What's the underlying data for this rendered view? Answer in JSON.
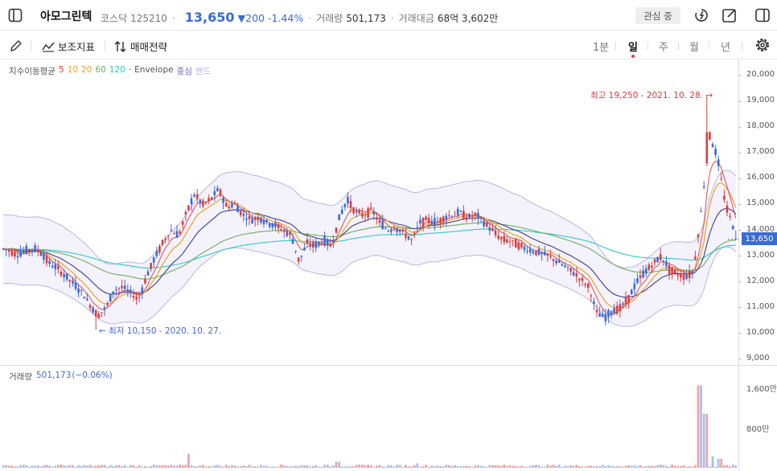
{
  "header": {
    "stock_name": "아모그린텍",
    "market": "코스닥",
    "code": "125210",
    "price": "13,650",
    "change": "▼200",
    "change_pct": "-1.44%",
    "volume_label": "거래량",
    "volume_value": "501,173",
    "amount_label": "거래대금",
    "amount_value": "68억 3,602만",
    "watch_label": "관심 중"
  },
  "toolbar": {
    "indicators_label": "보조지표",
    "strategy_label": "매매전략",
    "periods": [
      "1분",
      "일",
      "주",
      "월",
      "년"
    ],
    "active_period": "일"
  },
  "legend": {
    "title": "지수이동평균",
    "ma": [
      {
        "label": "5",
        "color": "#e23a3a"
      },
      {
        "label": "10",
        "color": "#f0a020"
      },
      {
        "label": "20",
        "color": "#f0a020"
      },
      {
        "label": "60",
        "color": "#6cae5a"
      },
      {
        "label": "120",
        "color": "#2fc9c9"
      }
    ],
    "envelope_label": "Envelope",
    "envelope_center": "중심",
    "envelope_band": "밴드"
  },
  "volume_legend": {
    "label": "거래량",
    "value": "501,173",
    "pct": "(−0.06%)"
  },
  "annotations": {
    "high": "최고 19,250 - 2021. 10. 28.",
    "low": "최저 10,150 - 2020. 10. 27."
  },
  "colors": {
    "up": "#e23a3a",
    "down": "#3b6bd6",
    "envelope": "#b7b3ea",
    "ma5": "#e23a3a",
    "ma10": "#f0a020",
    "ma20": "#3c3b8c",
    "ma60": "#6cae5a",
    "ma120": "#2fc9c9",
    "vol_up": "#f0a3a3",
    "vol_down": "#a9c0f0"
  },
  "chart_data": {
    "type": "candlestick",
    "price_axis": [
      "20,000",
      "19,000",
      "18,000",
      "17,000",
      "16,000",
      "15,000",
      "14,000",
      "13,000",
      "12,000",
      "11,000",
      "10,000",
      "9,000"
    ],
    "price_ylim": [
      9000,
      20000
    ],
    "volume_axis": [
      "1,600만",
      "800만"
    ],
    "last_price_tag": "13,650",
    "close_profile": [
      [
        0,
        13300
      ],
      [
        10,
        13200
      ],
      [
        20,
        13050
      ],
      [
        30,
        13200
      ],
      [
        40,
        13300
      ],
      [
        50,
        13100
      ],
      [
        60,
        12700
      ],
      [
        70,
        12500
      ],
      [
        80,
        12200
      ],
      [
        90,
        11900
      ],
      [
        100,
        11600
      ],
      [
        110,
        11100
      ],
      [
        120,
        10700
      ],
      [
        130,
        11000
      ],
      [
        140,
        11700
      ],
      [
        150,
        11800
      ],
      [
        160,
        11600
      ],
      [
        170,
        11300
      ],
      [
        180,
        12200
      ],
      [
        190,
        12900
      ],
      [
        200,
        13500
      ],
      [
        210,
        14000
      ],
      [
        220,
        13800
      ],
      [
        230,
        14700
      ],
      [
        240,
        15400
      ],
      [
        250,
        15000
      ],
      [
        260,
        15200
      ],
      [
        270,
        15600
      ],
      [
        280,
        14900
      ],
      [
        290,
        15000
      ],
      [
        300,
        14600
      ],
      [
        310,
        14400
      ],
      [
        320,
        14500
      ],
      [
        330,
        14300
      ],
      [
        340,
        14200
      ],
      [
        350,
        14000
      ],
      [
        360,
        13800
      ],
      [
        370,
        12800
      ],
      [
        380,
        13500
      ],
      [
        390,
        13400
      ],
      [
        400,
        13600
      ],
      [
        410,
        13400
      ],
      [
        420,
        14500
      ],
      [
        430,
        15200
      ],
      [
        440,
        14700
      ],
      [
        450,
        14600
      ],
      [
        460,
        14800
      ],
      [
        470,
        14300
      ],
      [
        480,
        14000
      ],
      [
        490,
        14100
      ],
      [
        500,
        13900
      ],
      [
        510,
        13600
      ],
      [
        520,
        14300
      ],
      [
        530,
        14400
      ],
      [
        540,
        14300
      ],
      [
        550,
        14500
      ],
      [
        560,
        14600
      ],
      [
        570,
        14700
      ],
      [
        580,
        14500
      ],
      [
        590,
        14600
      ],
      [
        600,
        14300
      ],
      [
        610,
        14000
      ],
      [
        620,
        13700
      ],
      [
        630,
        13600
      ],
      [
        640,
        13500
      ],
      [
        650,
        13300
      ],
      [
        660,
        13200
      ],
      [
        670,
        13100
      ],
      [
        680,
        13000
      ],
      [
        690,
        12800
      ],
      [
        700,
        12600
      ],
      [
        710,
        12400
      ],
      [
        720,
        12100
      ],
      [
        730,
        11800
      ],
      [
        740,
        10800
      ],
      [
        750,
        10600
      ],
      [
        760,
        10900
      ],
      [
        770,
        11000
      ],
      [
        780,
        11400
      ],
      [
        790,
        12000
      ],
      [
        800,
        12400
      ],
      [
        810,
        12700
      ],
      [
        820,
        13000
      ],
      [
        830,
        12500
      ],
      [
        840,
        12300
      ],
      [
        850,
        12200
      ],
      [
        860,
        12400
      ],
      [
        870,
        14800
      ],
      [
        880,
        17700
      ],
      [
        890,
        16800
      ],
      [
        900,
        15000
      ],
      [
        910,
        14100
      ],
      [
        915,
        13650
      ]
    ],
    "volume_spikes": [
      [
        235,
        280
      ],
      [
        420,
        120
      ],
      [
        520,
        90
      ],
      [
        870,
        1650
      ],
      [
        877,
        1080
      ],
      [
        885,
        230
      ],
      [
        895,
        180
      ]
    ]
  }
}
